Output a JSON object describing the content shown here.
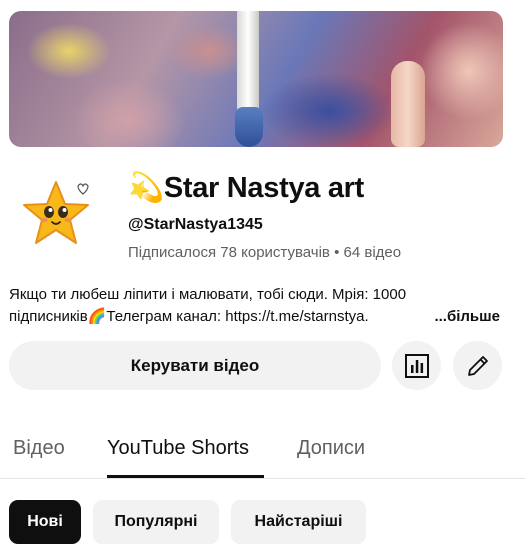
{
  "channel": {
    "name_emoji": "💫",
    "name": "Star Nastya art",
    "handle": "@StarNastya1345",
    "subscribers": "Підписалося 78 користувачів",
    "separator": "•",
    "videos": "64 відео"
  },
  "description": {
    "line1": "Якщо ти любеш ліпити і малювати, тобі сюди. Мрія: 1000",
    "line2": "підписників🌈Телеграм канал: https://t.me/starnstya.",
    "more_label": "...більше"
  },
  "actions": {
    "manage_videos_label": "Керувати відео",
    "analytics_icon": "analytics-icon",
    "edit_icon": "edit-pencil-icon"
  },
  "tabs": [
    {
      "label": "Відео",
      "active": false
    },
    {
      "label": "YouTube Shorts",
      "active": true
    },
    {
      "label": "Дописи",
      "active": false
    }
  ],
  "chips": [
    {
      "label": "Нові",
      "active": true
    },
    {
      "label": "Популярні",
      "active": false
    },
    {
      "label": "Найстаріші",
      "active": false
    }
  ],
  "colors": {
    "text_primary": "#0f0f0f",
    "text_secondary": "#606060",
    "button_bg": "#f2f2f2",
    "chip_active_bg": "#0f0f0f"
  }
}
